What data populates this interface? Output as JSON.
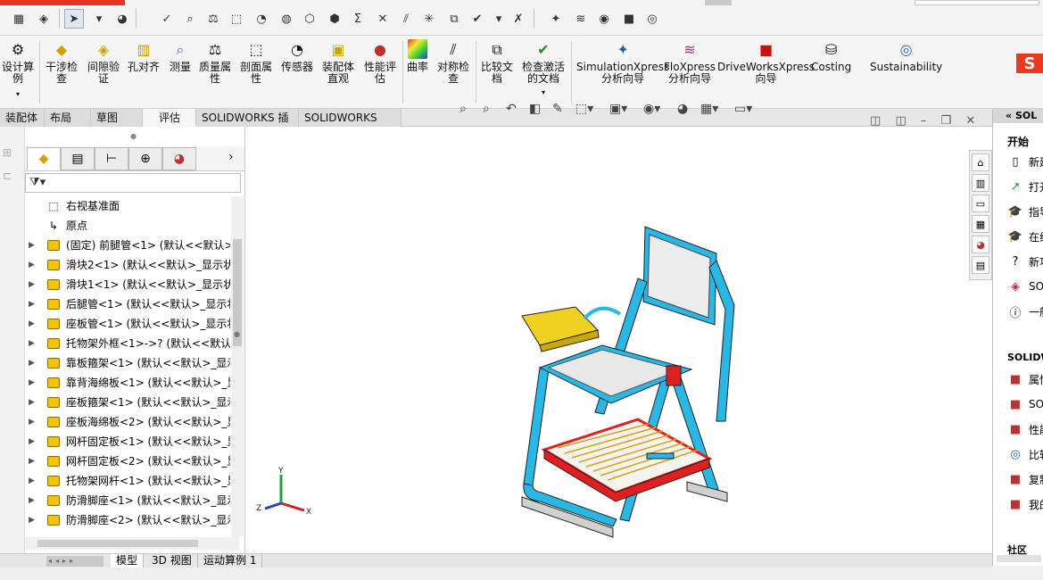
{
  "ribbon": {
    "buttons": [
      {
        "label": "设计算\n例",
        "icon": "design-study-icon"
      },
      {
        "label": "干涉检\n查",
        "icon": "interference-check-icon"
      },
      {
        "label": "间隙验\n证",
        "icon": "clearance-verification-icon"
      },
      {
        "label": "孔对齐",
        "icon": "hole-alignment-icon"
      },
      {
        "label": "测量",
        "icon": "measure-icon"
      },
      {
        "label": "质量属\n性",
        "icon": "mass-properties-icon"
      },
      {
        "label": "剖面属\n性",
        "icon": "section-properties-icon"
      },
      {
        "label": "传感器",
        "icon": "sensor-icon"
      },
      {
        "label": "装配体\n直观",
        "icon": "assembly-visualization-icon"
      },
      {
        "label": "性能评\n估",
        "icon": "performance-evaluation-icon"
      },
      {
        "label": "曲率",
        "icon": "curvature-icon"
      },
      {
        "label": "对称检\n查",
        "icon": "symmetry-check-icon"
      },
      {
        "label": "比较文\n档",
        "icon": "compare-documents-icon"
      },
      {
        "label": "检查激活\n的文档",
        "icon": "check-active-document-icon"
      },
      {
        "label": "SimulationXpress\n分析向导",
        "icon": "simulationxpress-icon"
      },
      {
        "label": "FloXpress\n分析向导",
        "icon": "floxpress-icon"
      },
      {
        "label": "DriveWorksXpress\n向导",
        "icon": "driveworksxpress-icon"
      },
      {
        "label": "Costing",
        "icon": "costing-icon"
      },
      {
        "label": "Sustainability",
        "icon": "sustainability-icon"
      }
    ]
  },
  "tabs": [
    "装配体",
    "布局",
    "草图",
    "评估",
    "SOLIDWORKS 插件",
    "SOLIDWORKS MBD"
  ],
  "active_tab": "评估",
  "tree": {
    "items": [
      {
        "text": "右视基准面",
        "kind": "plane",
        "expandable": false
      },
      {
        "text": "原点",
        "kind": "origin",
        "expandable": false
      },
      {
        "text": "(固定) 前腿管<1> (默认<<默认>_",
        "kind": "part",
        "expandable": true
      },
      {
        "text": "滑块2<1> (默认<<默认>_显示状",
        "kind": "part",
        "expandable": true
      },
      {
        "text": "滑块1<1> (默认<<默认>_显示状",
        "kind": "part",
        "expandable": true
      },
      {
        "text": "后腿管<1> (默认<<默认>_显示状",
        "kind": "part",
        "expandable": true
      },
      {
        "text": "座板管<1> (默认<<默认>_显示状",
        "kind": "part",
        "expandable": true
      },
      {
        "text": "托物架外框<1>->? (默认<<默认>",
        "kind": "part",
        "expandable": true
      },
      {
        "text": "靠板箍架<1> (默认<<默认>_显示",
        "kind": "part",
        "expandable": true
      },
      {
        "text": "靠背海绵板<1> (默认<<默认>_显",
        "kind": "part",
        "expandable": true
      },
      {
        "text": "座板箍架<1> (默认<<默认>_显示",
        "kind": "part",
        "expandable": true
      },
      {
        "text": "座板海绵板<2> (默认<<默认>_显",
        "kind": "part",
        "expandable": true
      },
      {
        "text": "网杆固定板<1> (默认<<默认>_显",
        "kind": "part",
        "expandable": true
      },
      {
        "text": "网杆固定板<2> (默认<<默认>_显",
        "kind": "part",
        "expandable": true
      },
      {
        "text": "托物架网杆<1> (默认<<默认>_显",
        "kind": "part",
        "expandable": true
      },
      {
        "text": "防滑脚座<1> (默认<<默认>_显示",
        "kind": "part",
        "expandable": true
      },
      {
        "text": "防滑脚座<2> (默认<<默认>_显示",
        "kind": "part",
        "expandable": true
      }
    ]
  },
  "bottom_tabs": [
    "模型",
    "3D 视图",
    "运动算例 1"
  ],
  "task_pane": {
    "header": "SOL",
    "section1": "开始",
    "items1": [
      {
        "label": "新建",
        "icon": "new-document-icon"
      },
      {
        "label": "打开",
        "icon": "open-document-icon"
      },
      {
        "label": "指导",
        "icon": "tutorial-icon"
      },
      {
        "label": "在线",
        "icon": "online-icon"
      },
      {
        "label": "新功",
        "icon": "whats-new-icon"
      },
      {
        "label": "SOL",
        "icon": "solidworks-icon"
      },
      {
        "label": "一般",
        "icon": "info-icon"
      }
    ],
    "section2": "SOLIDW",
    "items2": [
      {
        "label": "属性",
        "icon": "properties-icon"
      },
      {
        "label": "SOL",
        "icon": "sw-rx-icon"
      },
      {
        "label": "性能",
        "icon": "performance-icon"
      },
      {
        "label": "比较",
        "icon": "compare-icon"
      },
      {
        "label": "复制",
        "icon": "copy-settings-icon"
      },
      {
        "label": "我的",
        "icon": "my-products-icon"
      }
    ],
    "section3": "社区"
  },
  "axes": {
    "x": "X",
    "y": "Y",
    "z": "Z"
  },
  "colors": {
    "frame": "#29b8e6",
    "seat": "#e8e8e8",
    "accent_red": "#e02020",
    "tray": "#f0d020"
  }
}
